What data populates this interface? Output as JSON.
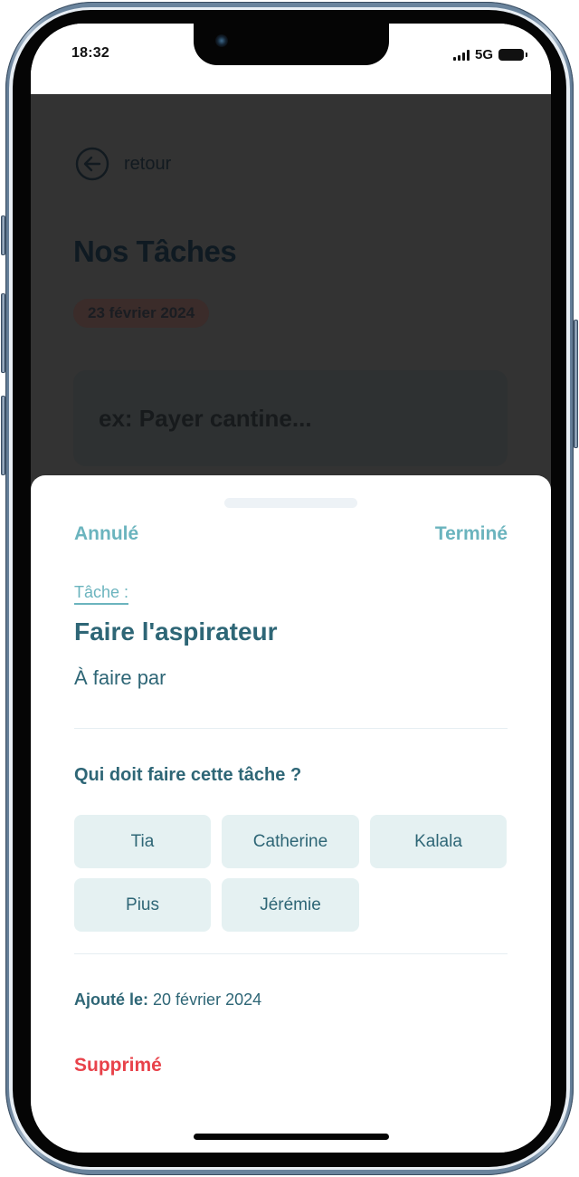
{
  "status_bar": {
    "time": "18:32",
    "network": "5G",
    "icons": [
      "signal-icon",
      "battery-icon"
    ]
  },
  "background_page": {
    "back_label": "retour",
    "back_icon": "arrow-left-circle-icon",
    "title": "Nos Tâches",
    "date_chip": "23 février 2024",
    "task_input_placeholder": "ex: Payer cantine..."
  },
  "sheet": {
    "cancel_label": "Annulé",
    "done_label": "Terminé",
    "field_label": "Tâche :",
    "task_name": "Faire l'aspirateur",
    "assignee_text": "À faire par",
    "who_title": "Qui doit faire cette tâche ?",
    "people": [
      "Tia",
      "Catherine",
      "Kalala",
      "Pius",
      "Jérémie"
    ],
    "added_label": "Ajouté le:",
    "added_date": "20 février 2024",
    "delete_label": "Supprimé"
  },
  "colors": {
    "accent": "#6bb4be",
    "primary_text": "#2e6676",
    "chip_bg": "#e5f1f2",
    "danger": "#e8424a",
    "overlay": "#333333"
  }
}
